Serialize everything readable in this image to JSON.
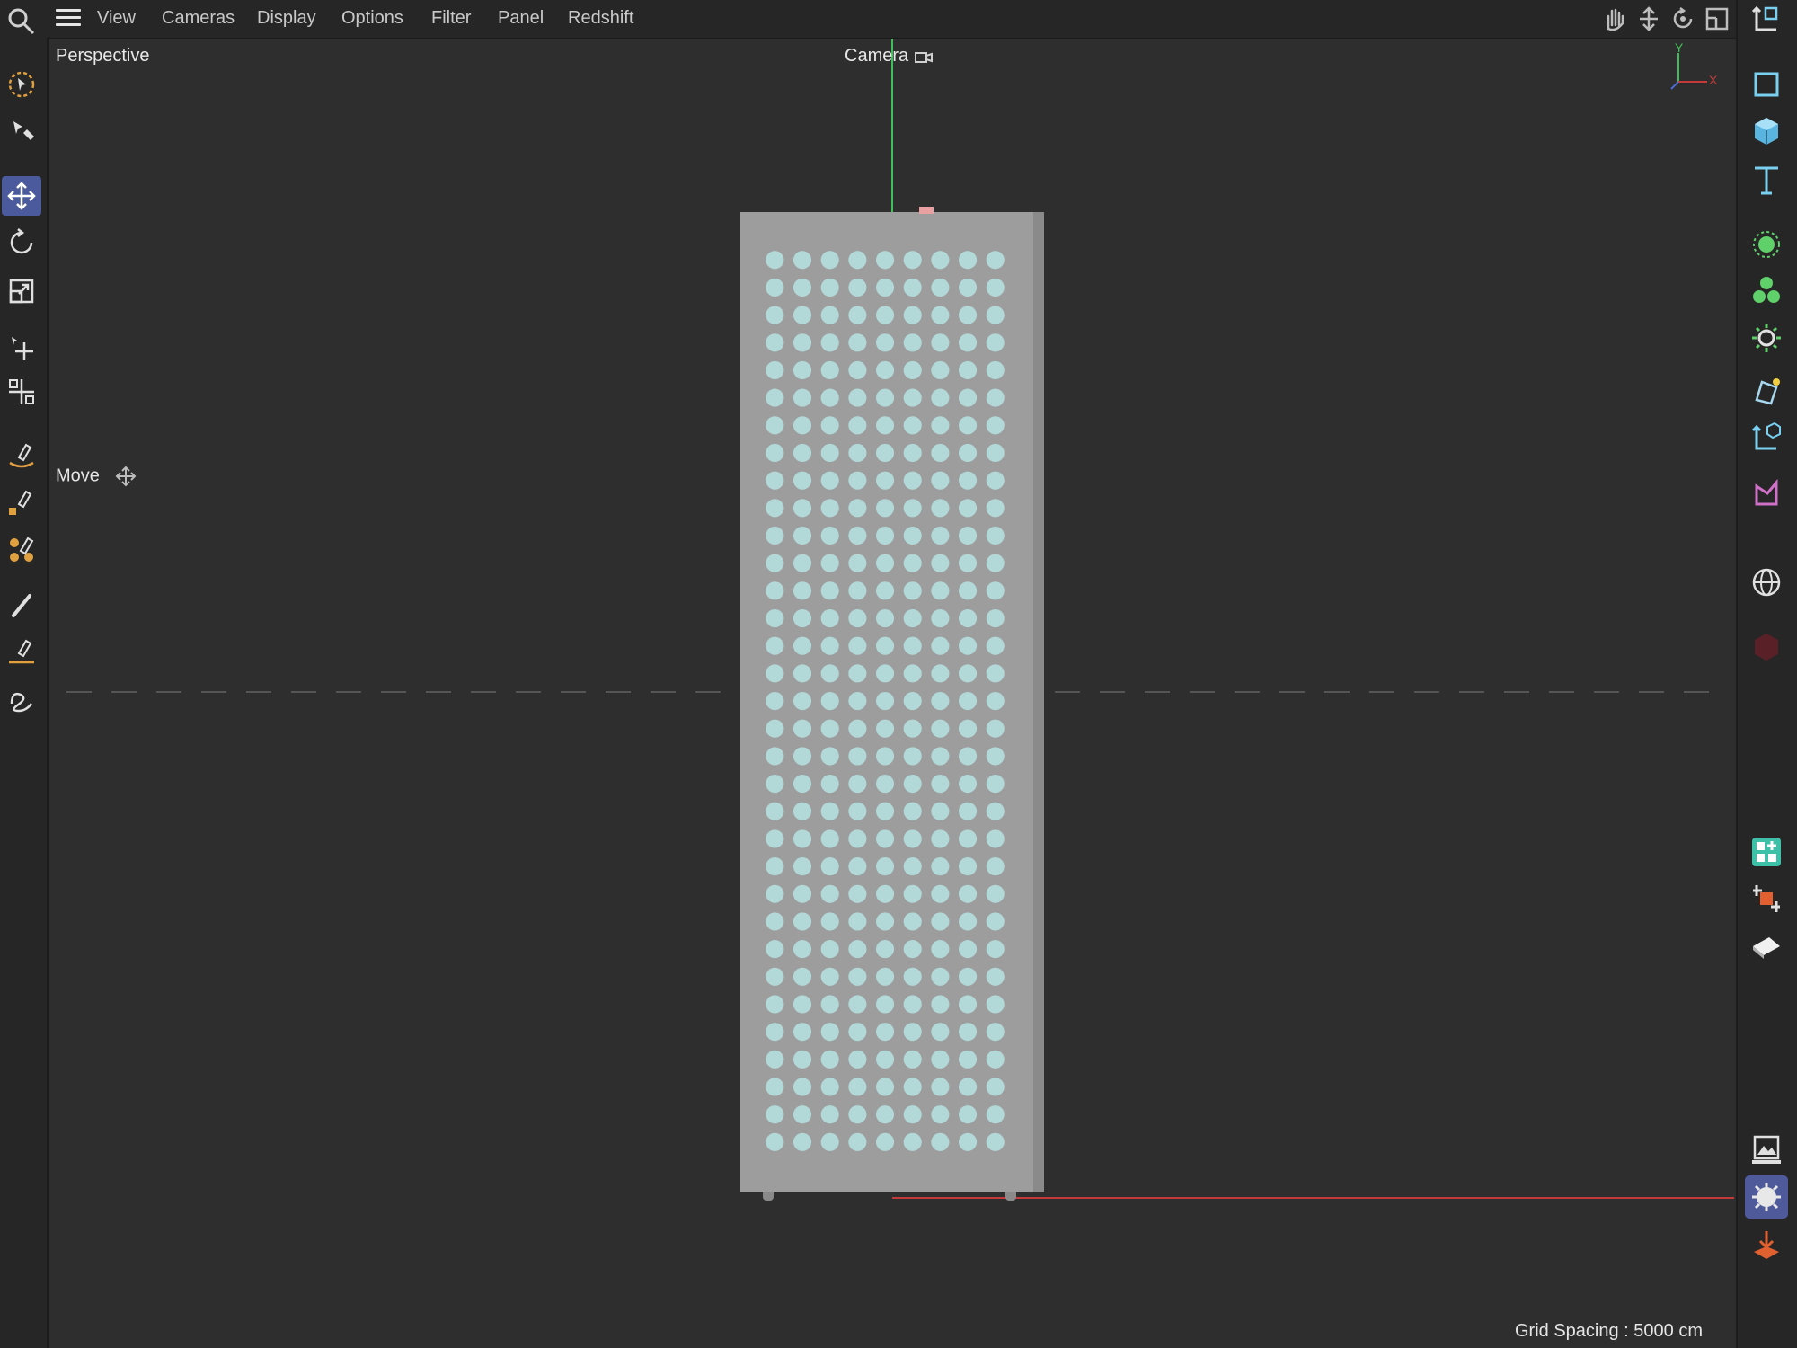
{
  "menubar": {
    "items": [
      "View",
      "Cameras",
      "Display",
      "Options",
      "Filter",
      "Panel",
      "Redshift"
    ]
  },
  "viewport": {
    "view_name": "Perspective",
    "camera_label": "Camera",
    "tool_label": "Move",
    "grid_spacing": "Grid Spacing : 5000 cm",
    "axis_y": "Y",
    "axis_x": "X"
  },
  "colors": {
    "background": "#2e2e2e",
    "toolbar": "#262626",
    "active_tool": "#4a5a9c",
    "object_panel": "#9d9d9d",
    "perforation": "#b2d8d8",
    "x_axis": "#c43a3a",
    "y_axis": "#3fbf5a"
  },
  "left_tools": [
    "live-selection-icon",
    "selection-tools-icon",
    "move-icon",
    "rotate-icon",
    "scale-icon",
    "transfer-icon",
    "multi-transfer-icon",
    "spline-pen-icon",
    "spline-sketch-icon",
    "spline-smooth-icon",
    "brush-icon",
    "spline-draw-icon",
    "lasso-spline-icon"
  ],
  "right_tools": [
    "model-mode-icon",
    "cube-icon",
    "text-icon",
    "generator-icon",
    "cloner-icon",
    "deformer-icon",
    "field-icon",
    "coordinate-icon",
    "motion-icon",
    "sky-icon",
    "redshift-material-icon",
    "asset-browser-icon",
    "scene-nodes-icon",
    "plane-icon",
    "picture-viewer-icon",
    "render-settings-icon",
    "render-export-icon"
  ],
  "object": {
    "columns": 9,
    "rows": 33
  }
}
